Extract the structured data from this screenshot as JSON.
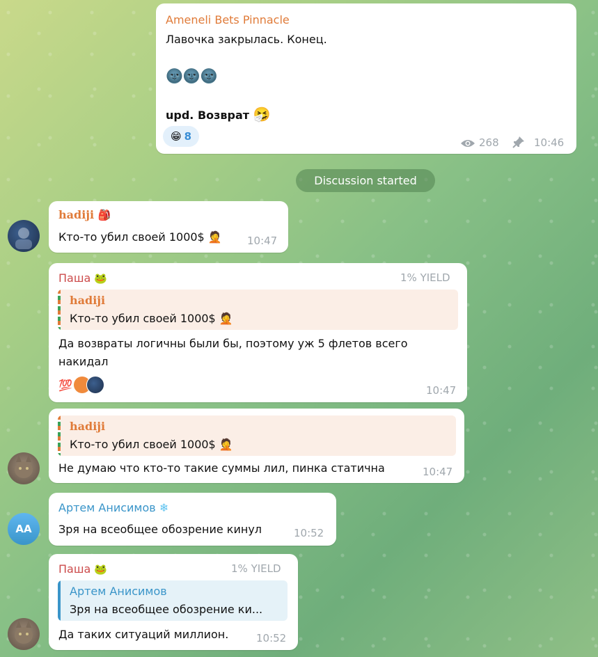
{
  "channel_post": {
    "sender": "Ameneli Bets Pinnacle",
    "line1": "Лавочка закрылась. Конец.",
    "emojis": "🌚🌚🌚",
    "line3": "upd. Возврат",
    "line3_emoji": "🤧",
    "reaction_emoji": "😁",
    "reaction_count": "8",
    "views": "268",
    "time": "10:46"
  },
  "service_pill": "Discussion started",
  "messages": {
    "m1": {
      "sender": "hadiji",
      "sender_badge": "🎒",
      "text": "Кто-то убил своей 1000$",
      "text_emoji": "🤦",
      "time": "10:47"
    },
    "m2": {
      "sender": "Паша",
      "sender_badge": "🐸",
      "tag": "1% YIELD",
      "quote_name": "hadiji",
      "quote_text": "Кто-то убил своей 1000$",
      "quote_emoji": "🤦",
      "text_line1": "Да возвраты логичны были бы, поэтому уж 5 флетов всего",
      "text_line2": "накидал",
      "reaction1": "💯",
      "time": "10:47"
    },
    "m3": {
      "quote_name": "hadiji",
      "quote_text": "Кто-то убил своей 1000$",
      "quote_emoji": "🤦",
      "text": "Не думаю что кто-то такие суммы лил, пинка статична",
      "time": "10:47"
    },
    "m4": {
      "sender": "Артем Анисимов",
      "sender_badge": "❄",
      "avatar_initials": "АА",
      "text": "Зря на всеобщее обозрение кинул",
      "time": "10:52"
    },
    "m5": {
      "sender": "Паша",
      "sender_badge": "🐸",
      "tag": "1% YIELD",
      "quote_name": "Артем Анисимов",
      "quote_text": "Зря на всеобщее обозрение ки...",
      "text": "Да таких ситуаций миллион.",
      "time": "10:52"
    }
  },
  "colors": {
    "orange_sender": "#e07b39",
    "red_sender": "#cc4b4b",
    "blue_sender": "#3a95c9",
    "time_gray": "#a0a7ad"
  }
}
